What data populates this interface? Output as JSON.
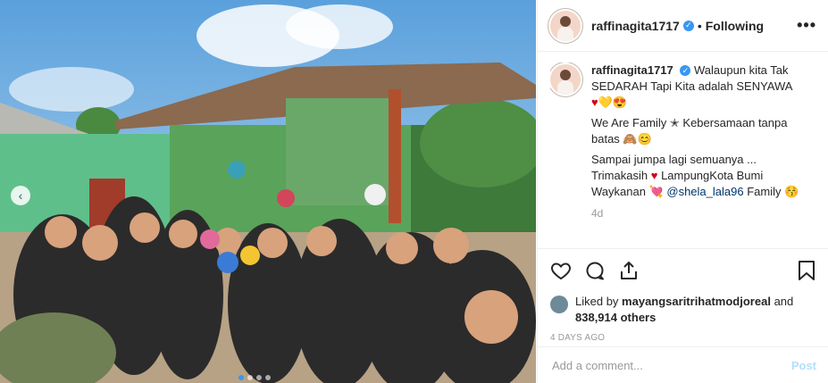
{
  "post": {
    "username": "raffinagita1717",
    "follow_status": "Following",
    "more_glyph": "•••",
    "bullet": "•",
    "verified_glyph": "✓"
  },
  "caption": {
    "username": "raffinagita1717",
    "line1": "Walaupun kita Tak SEDARAH Tapi Kita adalah SENYAWA",
    "emoji1": "♥💛😍",
    "line2": "We Are Family ✭ Kebersamaan tanpa batas 🙈😊",
    "line3": "Sampai jumpa lagi semuanya ...",
    "line4_a": "Trimakasih",
    "line4_heart": "♥",
    "line4_b": "LampungKota Bumi Waykanan",
    "line4_heart2": "💘",
    "mention": "@shela_lala96",
    "line4_c": "Family",
    "line4_emoji": "😚",
    "time": "4d"
  },
  "likes": {
    "prefix": "Liked by",
    "liker": "mayangsaritrihatmodjoreal",
    "and": "and",
    "others": "838,914 others"
  },
  "posted": "4 DAYS AGO",
  "comment_box": {
    "placeholder": "Add a comment...",
    "post_label": "Post"
  },
  "photo": {
    "prev_glyph": "‹",
    "dots": [
      true,
      false,
      false,
      false
    ]
  },
  "icons": [
    "heart-icon",
    "comment-icon",
    "share-icon",
    "bookmark-icon"
  ]
}
